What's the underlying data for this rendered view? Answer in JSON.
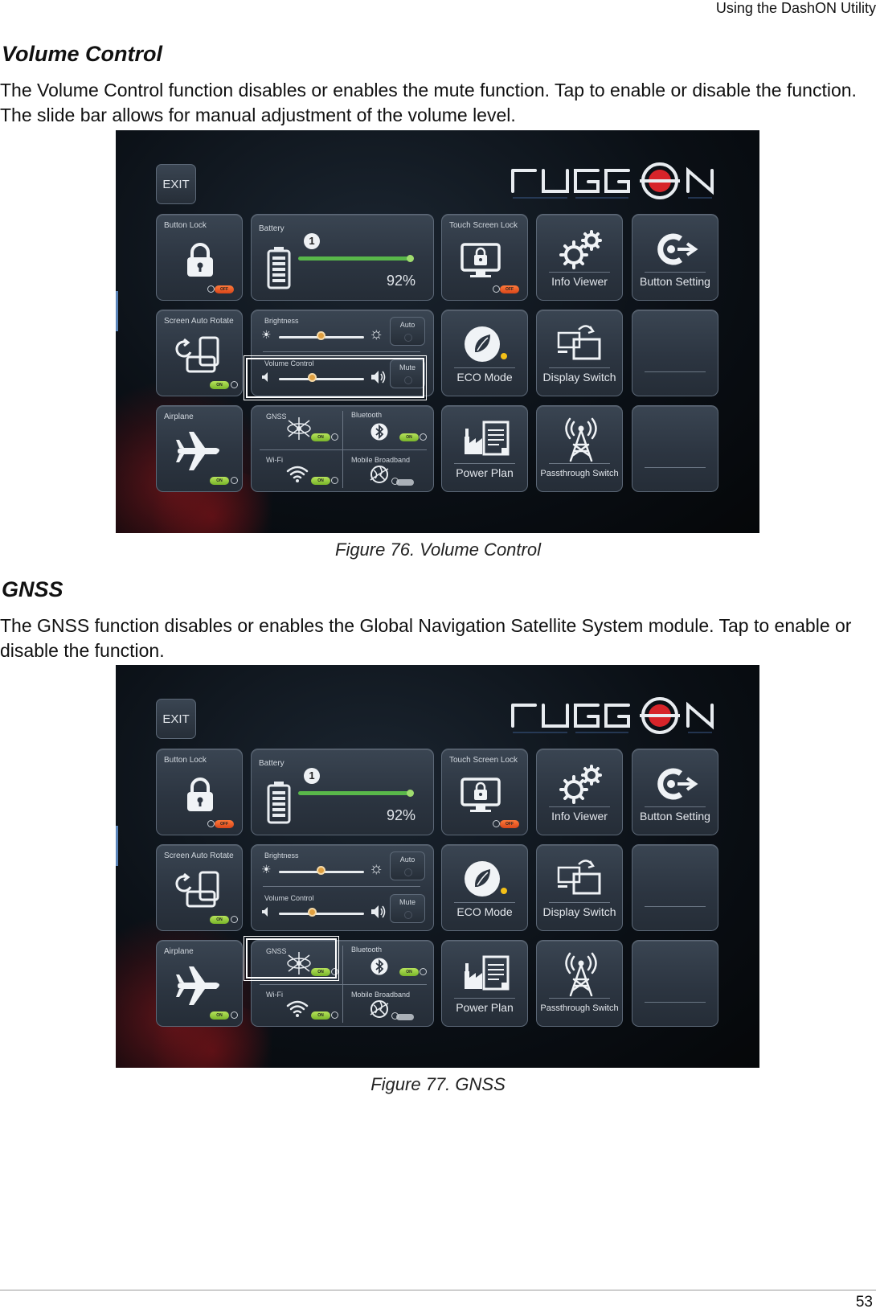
{
  "header": {
    "running_title": "Using the DashON Utility"
  },
  "sections": [
    {
      "title": "Volume Control",
      "paragraph": "The Volume Control function disables or enables the mute function. Tap to enable or disable the function. The slide bar allows for manual adjustment of the volume level.",
      "caption": "Figure 76.  Volume Control"
    },
    {
      "title": "GNSS",
      "paragraph": "The GNSS function disables or enables the Global Navigation Satellite System module. Tap to enable or disable the function.",
      "caption": "Figure 77.  GNSS"
    }
  ],
  "dashboard": {
    "exit_label": "EXIT",
    "logo_text": "RUGGON",
    "tiles": {
      "button_lock": "Button Lock",
      "battery": "Battery",
      "battery_percent": "92%",
      "battery_level": 0.92,
      "battery_badge": "1",
      "touch_screen_lock": "Touch Screen Lock",
      "info_viewer": "Info Viewer",
      "button_setting": "Button Setting",
      "screen_auto_rotate": "Screen Auto Rotate",
      "brightness": "Brightness",
      "brightness_auto": "Auto",
      "volume_control": "Volume Control",
      "volume_mute": "Mute",
      "eco_mode": "ECO Mode",
      "display_switch": "Display Switch",
      "airplane": "Airplane",
      "gnss": "GNSS",
      "bluetooth": "Bluetooth",
      "wifi": "Wi-Fi",
      "mobile_broadband": "Mobile Broadband",
      "power_plan": "Power Plan",
      "passthrough_switch": "Passthrough Switch",
      "toggle_off": "OFF",
      "toggle_on": "ON"
    },
    "brightness_level": 0.5,
    "volume_level": 0.4
  },
  "footer": {
    "page_number": "53"
  },
  "colors": {
    "tile_border": "#5c6877",
    "toggle_off": "#e85a24",
    "toggle_on": "#8ccc38",
    "battery_green": "#59b84a",
    "slider_thumb": "#e0a040",
    "logo_red": "#d7242a"
  }
}
